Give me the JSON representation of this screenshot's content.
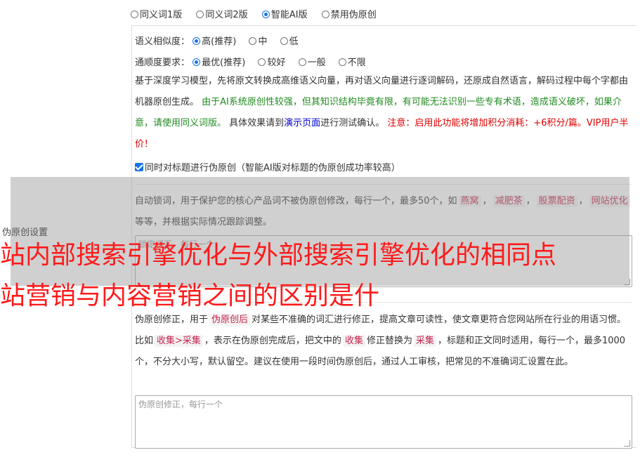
{
  "mode_options": [
    {
      "label": "同义词1版",
      "selected": false
    },
    {
      "label": "同义词2版",
      "selected": false
    },
    {
      "label": "智能AI版",
      "selected": true
    },
    {
      "label": "禁用伪原创",
      "selected": false
    }
  ],
  "similarity": {
    "label": "语义相似度：",
    "options": [
      {
        "label": "高(推荐)",
        "selected": true
      },
      {
        "label": "中",
        "selected": false
      },
      {
        "label": "低",
        "selected": false
      }
    ]
  },
  "fluency": {
    "label": "通顺度要求：",
    "options": [
      {
        "label": "最优(推荐)",
        "selected": true
      },
      {
        "label": "较好",
        "selected": false
      },
      {
        "label": "一般",
        "selected": false
      },
      {
        "label": "不限",
        "selected": false
      }
    ]
  },
  "description": {
    "p1": "基于深度学习模型，先将原文转换成高维语义向量，再对语义向量进行逐词解码，还原成自然语言，解码过程中每个字都由机器原创生成。",
    "green": "由于AI系统原创性较强，但其知识结构毕竟有限，有可能无法识别一些专有术语，造成语义破坏，如果介意，请使用同义词版。",
    "p2": "具体效果请到",
    "link": "演示页面",
    "p3": "进行测试确认。",
    "red": "注意：启用此功能将增加积分消耗：+6积分/篇。VIP用户半价！"
  },
  "title_checkbox": {
    "label": "同时对标题进行伪原创（智能AI版对标题的伪原创成功率较高）",
    "checked": true
  },
  "lock_words": {
    "desc_a": "自动锁词，用于保护您的核心产品词不被伪原创修改，每行一个，最多50个，如",
    "examples": [
      "燕窝",
      "减肥茶",
      "股票配资",
      "网站优化"
    ],
    "desc_b": "等等，并根据实际情况跟踪调整。",
    "placeholder": "锁定词汇，每行一个"
  },
  "correction": {
    "desc_a": "伪原创修正，用于",
    "code1": "伪原创后",
    "desc_b": "对某些不准确的词汇进行修正，提高文章可读性，使文章更符合您网站所在行业的用语习惯。比如",
    "code2": "收集>采集",
    "desc_c": "，表示在伪原创完成后，把文中的",
    "code3": "收集",
    "desc_d": "修正替换为",
    "code4": "采集",
    "desc_e": "，标题和正文同时适用，每行一个，最多1000个，不分大小写，默认留空。建议在使用一段时间伪原创后，通过人工审核，把常见的不准确词汇设置在此。",
    "placeholder": "伪原创修正，每行一个"
  },
  "section_label": "伪原创设置",
  "watermark": {
    "line1": "站内部搜索引擎优化与外部搜索引擎优化的相同点",
    "line2": "站营销与内容营销之间的区别是什"
  }
}
